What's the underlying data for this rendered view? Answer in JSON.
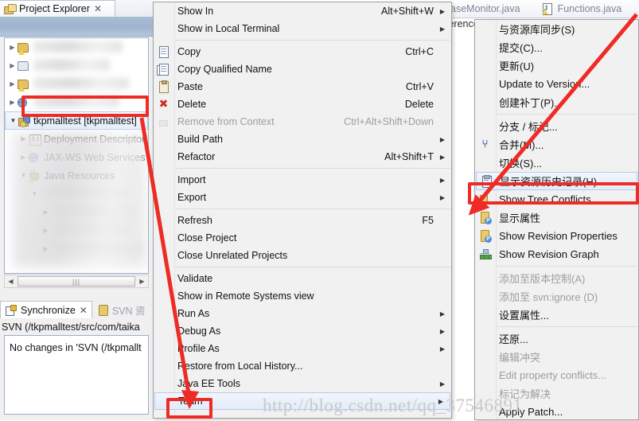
{
  "explorer": {
    "tab_label": "Project Explorer",
    "tab_close": "✕",
    "tree": [
      {
        "label": "",
        "blurred": true,
        "indent": 0,
        "twisty": "collapsed",
        "icon": "warning-folder-icon"
      },
      {
        "label": "",
        "blurred": true,
        "indent": 0,
        "twisty": "collapsed",
        "icon": "folder-icon"
      },
      {
        "label": "",
        "blurred": true,
        "indent": 0,
        "twisty": "collapsed",
        "icon": "warning-folder-icon"
      },
      {
        "label": "",
        "blurred": true,
        "indent": 0,
        "twisty": "collapsed",
        "icon": "web-project-icon"
      },
      {
        "label": "tkpmalltest [tkpmalltest]",
        "blurred": false,
        "indent": 0,
        "twisty": "expanded",
        "icon": "java-web-project-icon",
        "selected": true
      },
      {
        "label": "Deployment Descriptor",
        "blurred": false,
        "indent": 1,
        "twisty": "collapsed",
        "icon": "deployment-descriptor-icon"
      },
      {
        "label": "JAX-WS Web Services",
        "blurred": false,
        "indent": 1,
        "twisty": "collapsed",
        "icon": "globe-icon"
      },
      {
        "label": "Java Resources",
        "blurred": false,
        "indent": 1,
        "twisty": "expanded",
        "icon": "java-resources-icon"
      },
      {
        "label": "",
        "blurred": true,
        "indent": 2,
        "twisty": "expanded",
        "icon": "folder-icon"
      },
      {
        "label": "",
        "blurred": true,
        "indent": 3,
        "twisty": "collapsed",
        "icon": "package-icon"
      },
      {
        "label": "",
        "blurred": true,
        "indent": 3,
        "twisty": "collapsed",
        "icon": "package-icon"
      },
      {
        "label": "",
        "blurred": true,
        "indent": 3,
        "twisty": "collapsed",
        "icon": "package-icon"
      }
    ],
    "scrollbar": {
      "left_arrow": "◀",
      "right_arrow": "▶",
      "grip": "|||"
    }
  },
  "sync_view": {
    "tabs": [
      {
        "label": "Synchronize",
        "active": true,
        "icon": "synchronize-icon",
        "close": "✕"
      },
      {
        "label": "SVN 资",
        "active": false,
        "icon": "svn-repo-icon"
      }
    ],
    "path": "SVN (/tkpmalltest/src/com/taika",
    "message": "No changes in 'SVN (/tkpmallt"
  },
  "editor": {
    "tabs": [
      {
        "label": "aseMonitor.java",
        "icon": "java-file-icon"
      },
      {
        "label": "Functions.java",
        "icon": "java-file-icon"
      }
    ],
    "subline": "ferences)"
  },
  "context_menu": {
    "items": [
      {
        "label": "Show In",
        "accel": "Alt+Shift+W",
        "arrow": true,
        "icon": null,
        "disabled": false
      },
      {
        "label": "Show in Local Terminal",
        "accel": "",
        "arrow": true,
        "icon": null,
        "disabled": false
      },
      {
        "separator": true
      },
      {
        "label": "Copy",
        "accel": "Ctrl+C",
        "arrow": false,
        "icon": "copy-icon",
        "disabled": false
      },
      {
        "label": "Copy Qualified Name",
        "accel": "",
        "arrow": false,
        "icon": "copy-qualified-icon",
        "disabled": false
      },
      {
        "label": "Paste",
        "accel": "Ctrl+V",
        "arrow": false,
        "icon": "paste-icon",
        "disabled": false
      },
      {
        "label": "Delete",
        "accel": "Delete",
        "arrow": false,
        "icon": "delete-icon",
        "disabled": false
      },
      {
        "label": "Remove from Context",
        "accel": "Ctrl+Alt+Shift+Down",
        "arrow": false,
        "icon": "remove-context-icon",
        "disabled": true
      },
      {
        "label": "Build Path",
        "accel": "",
        "arrow": true,
        "icon": null,
        "disabled": false
      },
      {
        "label": "Refactor",
        "accel": "Alt+Shift+T",
        "arrow": true,
        "icon": null,
        "disabled": false
      },
      {
        "separator": true
      },
      {
        "label": "Import",
        "accel": "",
        "arrow": true,
        "icon": null,
        "disabled": false
      },
      {
        "label": "Export",
        "accel": "",
        "arrow": true,
        "icon": null,
        "disabled": false
      },
      {
        "separator": true
      },
      {
        "label": "Refresh",
        "accel": "F5",
        "arrow": false,
        "icon": null,
        "disabled": false
      },
      {
        "label": "Close Project",
        "accel": "",
        "arrow": false,
        "icon": null,
        "disabled": false
      },
      {
        "label": "Close Unrelated Projects",
        "accel": "",
        "arrow": false,
        "icon": null,
        "disabled": false
      },
      {
        "separator": true
      },
      {
        "label": "Validate",
        "accel": "",
        "arrow": false,
        "icon": null,
        "disabled": false
      },
      {
        "label": "Show in Remote Systems view",
        "accel": "",
        "arrow": false,
        "icon": null,
        "disabled": false
      },
      {
        "label": "Run As",
        "accel": "",
        "arrow": true,
        "icon": null,
        "disabled": false
      },
      {
        "label": "Debug As",
        "accel": "",
        "arrow": true,
        "icon": null,
        "disabled": false
      },
      {
        "label": "Profile As",
        "accel": "",
        "arrow": true,
        "icon": null,
        "disabled": false
      },
      {
        "label": "Restore from Local History...",
        "accel": "",
        "arrow": false,
        "icon": null,
        "disabled": false
      },
      {
        "label": "Java EE Tools",
        "accel": "",
        "arrow": true,
        "icon": null,
        "disabled": false
      },
      {
        "label": "Team",
        "accel": "",
        "arrow": true,
        "icon": null,
        "disabled": false,
        "selected": true
      }
    ]
  },
  "submenu": {
    "items": [
      {
        "label": "与资源库同步(S)",
        "icon": null,
        "disabled": false
      },
      {
        "label": "提交(C)...",
        "icon": null,
        "disabled": false
      },
      {
        "label": "更新(U)",
        "icon": null,
        "disabled": false
      },
      {
        "label": "Update to Version...",
        "icon": null,
        "disabled": false
      },
      {
        "label": "创建补丁(P)...",
        "icon": null,
        "disabled": false
      },
      {
        "separator": true
      },
      {
        "label": "分支 / 标记...",
        "icon": null,
        "disabled": false
      },
      {
        "label": "合并(M)...",
        "icon": "merge-icon",
        "disabled": false
      },
      {
        "label": "切换(S)...",
        "icon": null,
        "disabled": false
      },
      {
        "label": "显示资源历史记录(H)",
        "icon": "history-icon",
        "disabled": false,
        "selected": true
      },
      {
        "label": "Show Tree Conflicts",
        "icon": "tree-conflicts-icon",
        "disabled": false
      },
      {
        "label": "显示属性",
        "icon": "properties-icon",
        "disabled": false
      },
      {
        "label": "Show Revision Properties",
        "icon": "revision-properties-icon",
        "disabled": false
      },
      {
        "label": "Show Revision Graph",
        "icon": "revision-graph-icon",
        "disabled": false
      },
      {
        "separator": true
      },
      {
        "label": "添加至版本控制(A)",
        "icon": null,
        "disabled": true
      },
      {
        "label": "添加至 svn:ignore (D)",
        "icon": null,
        "disabled": true
      },
      {
        "label": "设置属性...",
        "icon": null,
        "disabled": false
      },
      {
        "separator": true
      },
      {
        "label": "还原...",
        "icon": null,
        "disabled": false
      },
      {
        "label": "编辑冲突",
        "icon": null,
        "disabled": true
      },
      {
        "label": "Edit property conflicts...",
        "icon": null,
        "disabled": true
      },
      {
        "label": "标记为解决",
        "icon": null,
        "disabled": true
      },
      {
        "label": "Apply Patch...",
        "icon": null,
        "disabled": false
      }
    ]
  },
  "annotations": {
    "color": "#ee2b24",
    "boxes": [
      "project-node-highlight",
      "team-menu-item-highlight",
      "show-resource-history-highlight"
    ],
    "arrows": [
      "arrow-project-to-team",
      "arrow-team-to-history"
    ]
  },
  "watermark": {
    "text": "http://blog.csdn.net/qq_37546891"
  }
}
